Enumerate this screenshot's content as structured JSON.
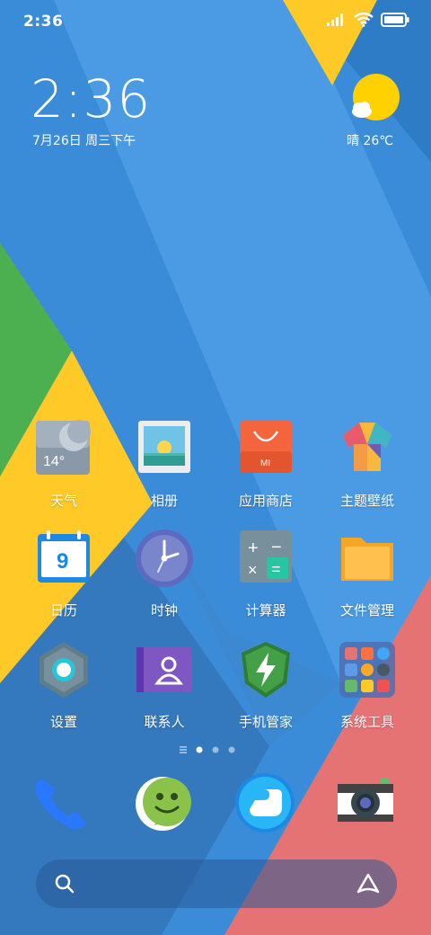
{
  "status_bar": {
    "time": "2:36",
    "icons": [
      "signal-icon",
      "wifi-icon",
      "battery-icon"
    ]
  },
  "clock_widget": {
    "time": "2:36",
    "date": "7月26日 周三下午"
  },
  "weather_widget": {
    "text": "晴 26℃",
    "icon": "sunny-weather-icon",
    "colors": {
      "sun": "#FFD100"
    }
  },
  "calendar_day": "9",
  "weather_app_temp": "14°",
  "apps": [
    {
      "label": "天气",
      "name": "weather-app"
    },
    {
      "label": "相册",
      "name": "gallery-app"
    },
    {
      "label": "应用商店",
      "name": "app-store-app"
    },
    {
      "label": "主题壁纸",
      "name": "themes-app"
    },
    {
      "label": "日历",
      "name": "calendar-app"
    },
    {
      "label": "时钟",
      "name": "clock-app"
    },
    {
      "label": "计算器",
      "name": "calculator-app"
    },
    {
      "label": "文件管理",
      "name": "file-manager-app"
    },
    {
      "label": "设置",
      "name": "settings-app"
    },
    {
      "label": "联系人",
      "name": "contacts-app"
    },
    {
      "label": "手机管家",
      "name": "security-app"
    },
    {
      "label": "系统工具",
      "name": "tools-folder"
    }
  ],
  "dock": [
    "phone-icon",
    "messages-icon",
    "browser-icon",
    "camera-icon"
  ],
  "page_indicator": {
    "pages": 3,
    "current": 1
  },
  "search_bar": {
    "icons": [
      "search-icon",
      "assistant-icon"
    ]
  },
  "colors": {
    "bg_blue": "#3A8BD8",
    "green": "#4CAF50",
    "yellow": "#FFC928",
    "red": "#E57373"
  }
}
